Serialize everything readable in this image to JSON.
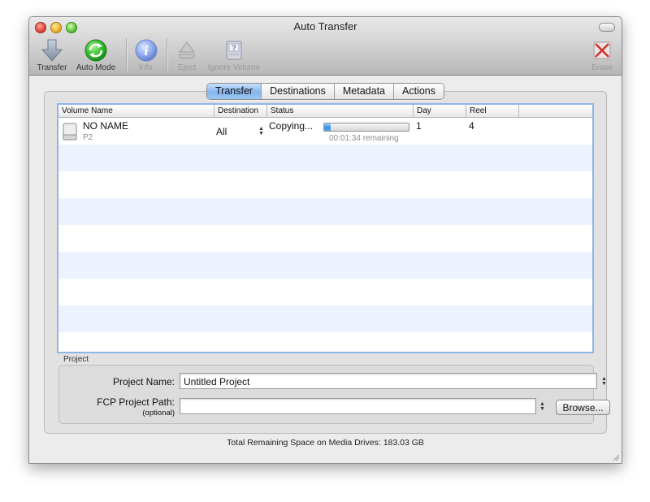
{
  "window": {
    "title": "Auto Transfer"
  },
  "toolbar": {
    "transfer": "Transfer",
    "auto_mode": "Auto Mode",
    "info": "Info",
    "eject": "Eject",
    "ignore_volume": "Ignore Volume",
    "erase": "Erase"
  },
  "tabs": [
    "Transfer",
    "Destinations",
    "Metadata",
    "Actions"
  ],
  "table": {
    "columns": [
      "Volume Name",
      "Destination",
      "Status",
      "Day",
      "Reel"
    ],
    "rows": [
      {
        "volume_name": "NO NAME",
        "volume_type": "P2",
        "destination": "All",
        "status": "Copying...",
        "remaining": "00:01:34 remaining",
        "progress": 0.08,
        "day": "1",
        "reel": "4"
      }
    ]
  },
  "project": {
    "group_label": "Project",
    "name_label": "Project Name:",
    "name_value": "Untitled Project",
    "path_label": "FCP Project Path:",
    "path_hint": "(optional)",
    "path_value": "",
    "browse_label": "Browse..."
  },
  "footer": {
    "text": "Total Remaining Space on Media Drives: 183.03 GB"
  },
  "colors": {
    "accent": "#86b6ef",
    "row_alt": "#edf3fe",
    "auto_mode": "#2fb82a",
    "info": "#6e8fe0",
    "erase": "#d0342c"
  }
}
